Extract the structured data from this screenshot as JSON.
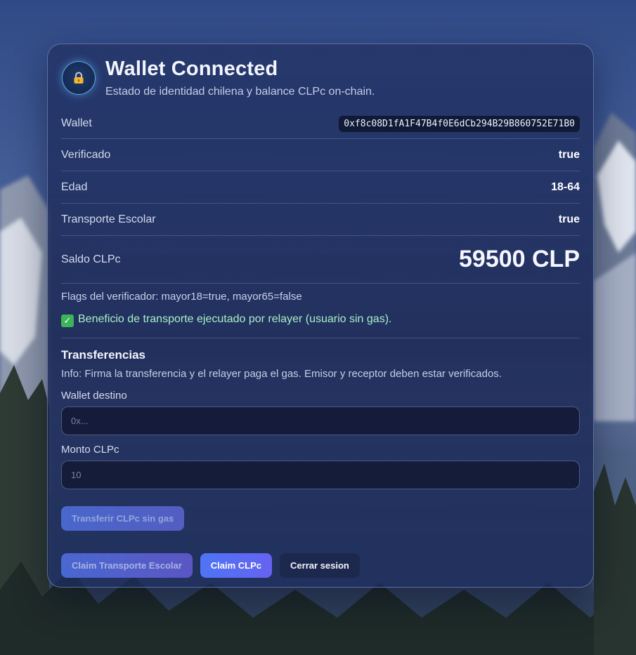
{
  "header": {
    "icon": "lock-icon",
    "title": "Wallet Connected",
    "subtitle": "Estado de identidad chilena y balance CLPc on-chain."
  },
  "details": {
    "wallet_label": "Wallet",
    "wallet_value": "0xf8c08D1fA1F47B4f0E6dCb294B29B860752E71B0",
    "verified_label": "Verificado",
    "verified_value": "true",
    "age_label": "Edad",
    "age_value": "18-64",
    "transport_label": "Transporte Escolar",
    "transport_value": "true",
    "balance_label": "Saldo CLPc",
    "balance_value": "59500 CLP"
  },
  "flags_text": "Flags del verificador: mayor18=true, mayor65=false",
  "success_message": {
    "icon": "check-mark-icon",
    "text": "Beneficio de transporte ejecutado por relayer (usuario sin gas)."
  },
  "transfers": {
    "title": "Transferencias",
    "info": "Info: Firma la transferencia y el relayer paga el gas. Emisor y receptor deben estar verificados.",
    "destination_label": "Wallet destino",
    "destination_placeholder": "0x...",
    "destination_value": "",
    "amount_label": "Monto CLPc",
    "amount_placeholder": "10",
    "amount_value": "",
    "submit_label": "Transferir CLPc sin gas"
  },
  "actions": {
    "claim_transport_label": "Claim Transporte Escolar",
    "claim_label": "Claim CLPc",
    "logout_label": "Cerrar sesion"
  },
  "colors": {
    "success_text": "#a6f0c9",
    "primary_button": "#4f74f5",
    "card_border": "#a0b9eb"
  }
}
